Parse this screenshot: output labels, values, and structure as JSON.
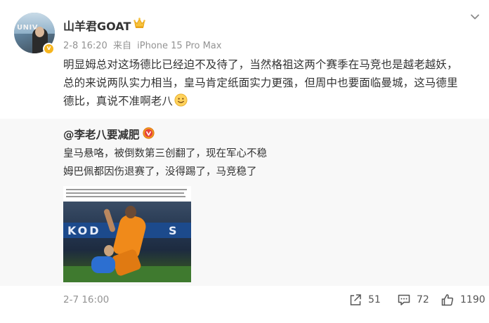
{
  "post": {
    "author": {
      "username": "山羊君GOAT",
      "avatar_text": "UNIV",
      "badge_icon": "crown-icon",
      "verified_color": "#f6b51e"
    },
    "meta": {
      "date": "2-8 16:20",
      "source_prefix": "来自",
      "device": "iPhone 15 Pro Max"
    },
    "text": {
      "line1": "明显姆总对这场德比已经迫不及待了，当然格祖这两个赛季在马竞也是越老越妖，",
      "line2": "总的来说两队实力相当，皇马肯定纸面实力更强，但周中也要面临曼城，这马德里",
      "line3": "德比，真说不准啊老八",
      "emoji": "smile-emoji"
    },
    "repost": {
      "author": "@李老八要减肥",
      "badge_icon": "red-v-icon",
      "line1": "皇马悬咯，被倒数第三创翻了，现在军心不稳",
      "line2": "姆巴佩都因伤退赛了，没得踢了，马竞稳了",
      "image": {
        "board_text": "KOD",
        "board_text2": "S"
      }
    },
    "footer": {
      "timestamp": "2-7 16:00",
      "share_count": "51",
      "comment_count": "72",
      "like_count": "1190"
    }
  },
  "colors": {
    "text": "#333333",
    "muted": "#939393",
    "repost_bg": "#f8f8f8",
    "accent_orange": "#f08a1a",
    "badge_red": "#e8403a"
  }
}
